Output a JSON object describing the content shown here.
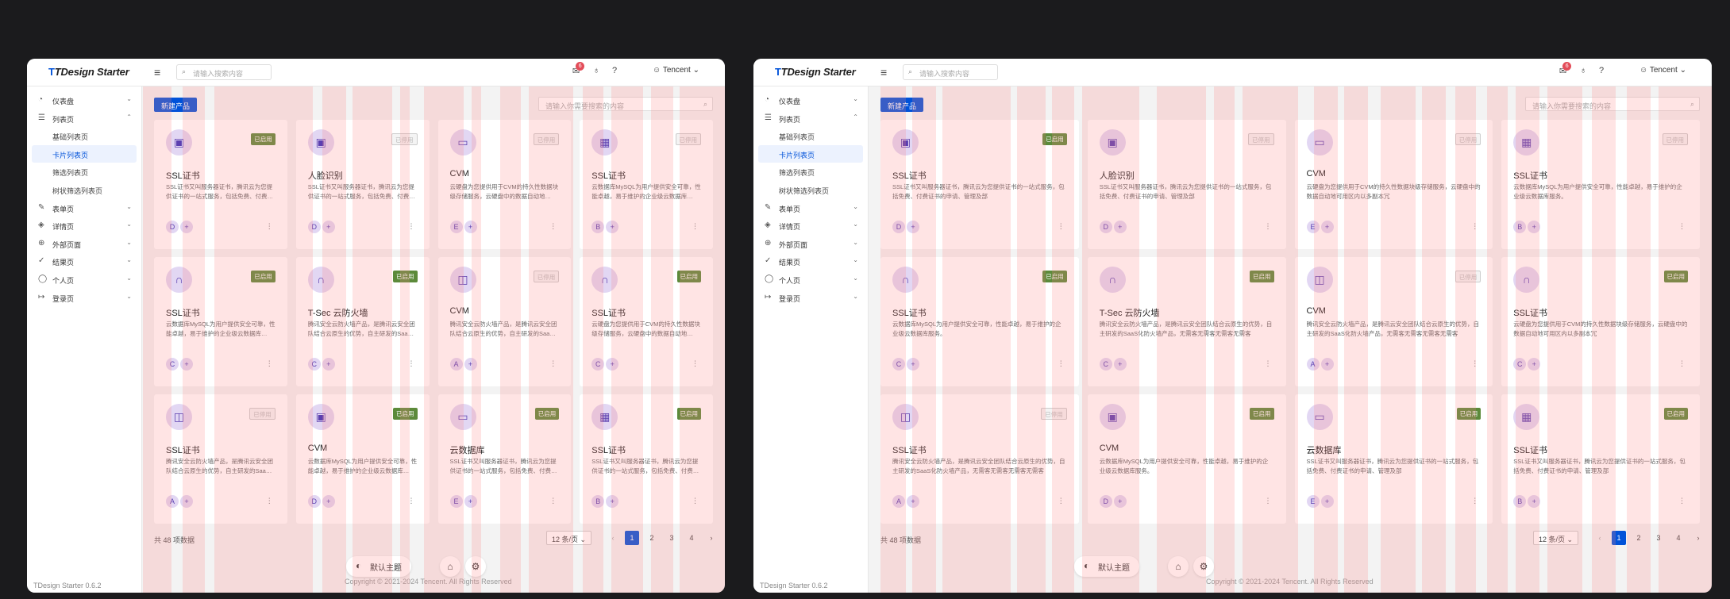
{
  "app": {
    "logo": "TDesign Starter",
    "search_placeholder": "请输入搜索内容",
    "notification_count": "6",
    "user": "Tencent",
    "version": "TDesign Starter 0.6.2",
    "copyright": "Copyright © 2021-2024 Tencent. All Rights Reserved"
  },
  "sidebar": {
    "items": [
      {
        "label": "仪表盘",
        "icon": "dashboard-icon"
      },
      {
        "label": "列表页",
        "icon": "list-icon"
      },
      {
        "label": "表单页",
        "icon": "edit-icon"
      },
      {
        "label": "详情页",
        "icon": "layers-icon"
      },
      {
        "label": "外部页面",
        "icon": "internet-icon"
      },
      {
        "label": "结果页",
        "icon": "check-circle-icon"
      },
      {
        "label": "个人页",
        "icon": "user-icon"
      },
      {
        "label": "登录页",
        "icon": "logout-icon"
      }
    ],
    "sub_items": [
      "基础列表页",
      "卡片列表页",
      "筛选列表页",
      "树状筛选列表页"
    ],
    "active_sub": "卡片列表页"
  },
  "toolbar": {
    "new_button": "新建产品",
    "card_search_placeholder": "请输入你需要搜索的内容"
  },
  "status": {
    "on": "已启用",
    "off": "已停用"
  },
  "cards": [
    {
      "title": "SSL证书",
      "icon": "user-card-icon",
      "enabled": true,
      "chip": "D",
      "desc_left": "SSL证书又叫服务器证书，腾讯云为您提供证书的一站式服务，包括免费、付费…",
      "desc_right": "SSL证书又叫服务器证书，腾讯云为您提供证书的一站式服务，包括免费、付费证书的申请、管理及部"
    },
    {
      "title": "人脸识别",
      "icon": "user-card-icon",
      "enabled": false,
      "chip": "D",
      "desc_left": "SSL证书又叫服务器证书，腾讯云为您提供证书的一站式服务，包括免费、付费…",
      "desc_right": "SSL证书又叫服务器证书，腾讯云为您提供证书的一站式服务，包括免费、付费证书的申请、管理及部"
    },
    {
      "title": "CVM",
      "icon": "laptop-icon",
      "enabled": false,
      "chip": "E",
      "desc_left": "云硬盘为您提供用于CVM的持久性数据块级存储服务，云硬盘中的数据自动地…",
      "desc_right": "云硬盘为您提供用于CVM的持久性数据块级存储服务，云硬盘中的数据自动地可用区内以多副本冗"
    },
    {
      "title": "SSL证书",
      "icon": "calendar-icon",
      "enabled": false,
      "chip": "B",
      "desc_left": "云数据库MySQL为用户提供安全可靠，性能卓越，易于维护的企业级云数据库…",
      "desc_right": "云数据库MySQL为用户提供安全可靠，性能卓越，易于维护的企业级云数据库服务。"
    },
    {
      "title": "SSL证书",
      "icon": "headset-icon",
      "enabled": true,
      "chip": "C",
      "desc_left": "云数据库MySQL为用户提供安全可靠，性能卓越，易于维护的企业级云数据库…",
      "desc_right": "云数据库MySQL为用户提供安全可靠，性能卓越，易于维护的企业级云数据库服务。"
    },
    {
      "title": "T-Sec 云防火墙",
      "icon": "headset-icon",
      "enabled": true,
      "chip": "C",
      "desc_left": "腾讯安全云防火墙产品，是腾讯云安全团队结合云原生的优势，自主研发的Saa…",
      "desc_right": "腾讯安全云防火墙产品，是腾讯云安全团队结合云原生的优势，自主研发的SaaS化防火墙产品，无需客无需客无需客无需客"
    },
    {
      "title": "CVM",
      "icon": "shop-icon",
      "enabled": false,
      "chip": "A",
      "desc_left": "腾讯安全云防火墙产品，是腾讯云安全团队结合云原生的优势，自主研发的Saa…",
      "desc_right": "腾讯安全云防火墙产品，是腾讯云安全团队结合云原生的优势，自主研发的SaaS化防火墙产品，无需客无需客无需客无需客"
    },
    {
      "title": "SSL证书",
      "icon": "headset-icon",
      "enabled": true,
      "chip": "C",
      "desc_left": "云硬盘为您提供用于CVM的持久性数据块级存储服务，云硬盘中的数据自动地…",
      "desc_right": "云硬盘为您提供用于CVM的持久性数据块级存储服务，云硬盘中的数据自动地可用区内以多副本冗"
    },
    {
      "title": "SSL证书",
      "icon": "shop-icon",
      "enabled": false,
      "chip": "A",
      "desc_left": "腾讯安全云防火墙产品，是腾讯云安全团队结合云原生的优势，自主研发的Saa…",
      "desc_right": "腾讯安全云防火墙产品，是腾讯云安全团队结合云原生的优势，自主研发的SaaS化防火墙产品，无需客无需客无需客无需客"
    },
    {
      "title": "CVM",
      "icon": "user-card-icon",
      "enabled": true,
      "chip": "D",
      "desc_left": "云数据库MySQL为用户提供安全可靠，性能卓越，易于维护的企业级云数据库…",
      "desc_right": "云数据库MySQL为用户提供安全可靠，性能卓越，易于维护的企业级云数据库服务。"
    },
    {
      "title": "云数据库",
      "icon": "laptop-icon",
      "enabled": true,
      "chip": "E",
      "desc_left": "SSL证书又叫服务器证书，腾讯云为您提供证书的一站式服务，包括免费、付费…",
      "desc_right": "SSL证书又叫服务器证书，腾讯云为您提供证书的一站式服务，包括免费、付费证书的申请、管理及部"
    },
    {
      "title": "SSL证书",
      "icon": "calendar-icon",
      "enabled": true,
      "chip": "B",
      "desc_left": "SSL证书又叫服务器证书，腾讯云为您提供证书的一站式服务，包括免费、付费…",
      "desc_right": "SSL证书又叫服务器证书，腾讯云为您提供证书的一站式服务，包括免费、付费证书的申请、管理及部"
    }
  ],
  "pagination": {
    "total": "共 48 项数据",
    "page_size": "12 条/页",
    "pages": [
      "1",
      "2",
      "3",
      "4"
    ],
    "current": "1"
  },
  "bottom": {
    "theme_label": "默认主题"
  },
  "colors": {
    "accent": "#0052d9",
    "enabled_tag": "#5c8a3a",
    "avatar_bg": "#e2d7f3",
    "overlay": "rgba(255,130,130,0.22)"
  }
}
